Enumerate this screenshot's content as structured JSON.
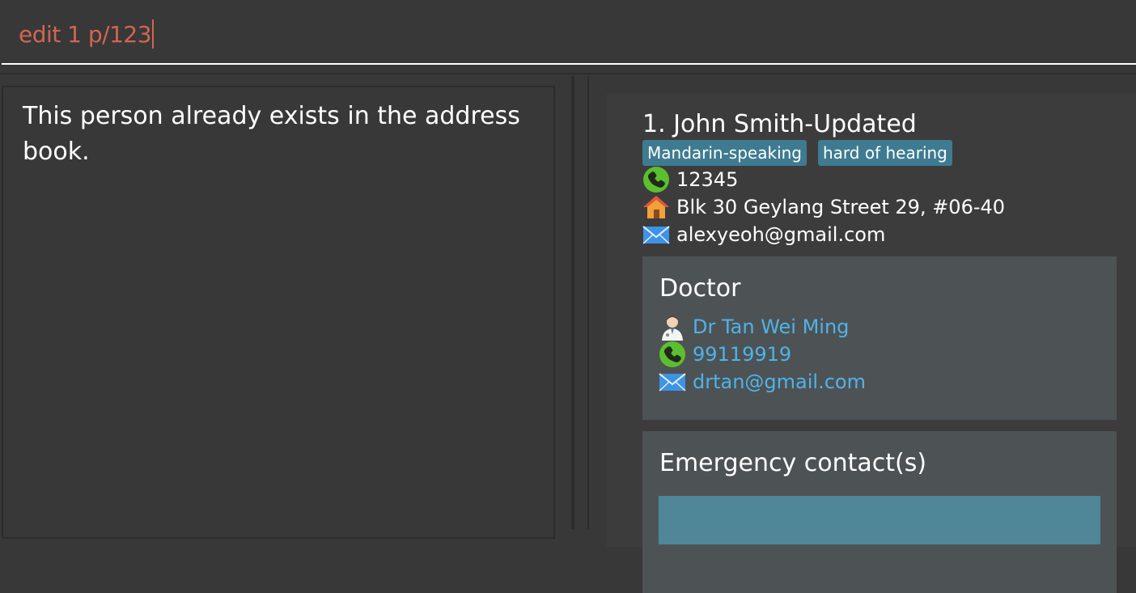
{
  "command": {
    "value": "edit 1 p/123"
  },
  "result": {
    "message": "This person already exists in the address book."
  },
  "person": {
    "index_name": "1. John Smith-Updated",
    "tags": [
      "Mandarin-speaking",
      "hard of hearing"
    ],
    "phone": "12345",
    "address": "Blk 30 Geylang Street 29, #06-40",
    "email": "alexyeoh@gmail.com",
    "icons": {
      "phone": "phone-icon",
      "address": "house-icon",
      "email": "envelope-icon"
    }
  },
  "doctor": {
    "heading": "Doctor",
    "name": "Dr Tan Wei Ming",
    "phone": "99119919",
    "email": "drtan@gmail.com",
    "icons": {
      "name": "doctor-icon",
      "phone": "phone-icon",
      "email": "envelope-icon"
    }
  },
  "emergency": {
    "heading": "Emergency contact(s)"
  },
  "colors": {
    "background": "#383838",
    "command_text": "#d06651",
    "tag": "#3e7b91",
    "box": "#4d5355",
    "link": "#4fb3e8"
  }
}
